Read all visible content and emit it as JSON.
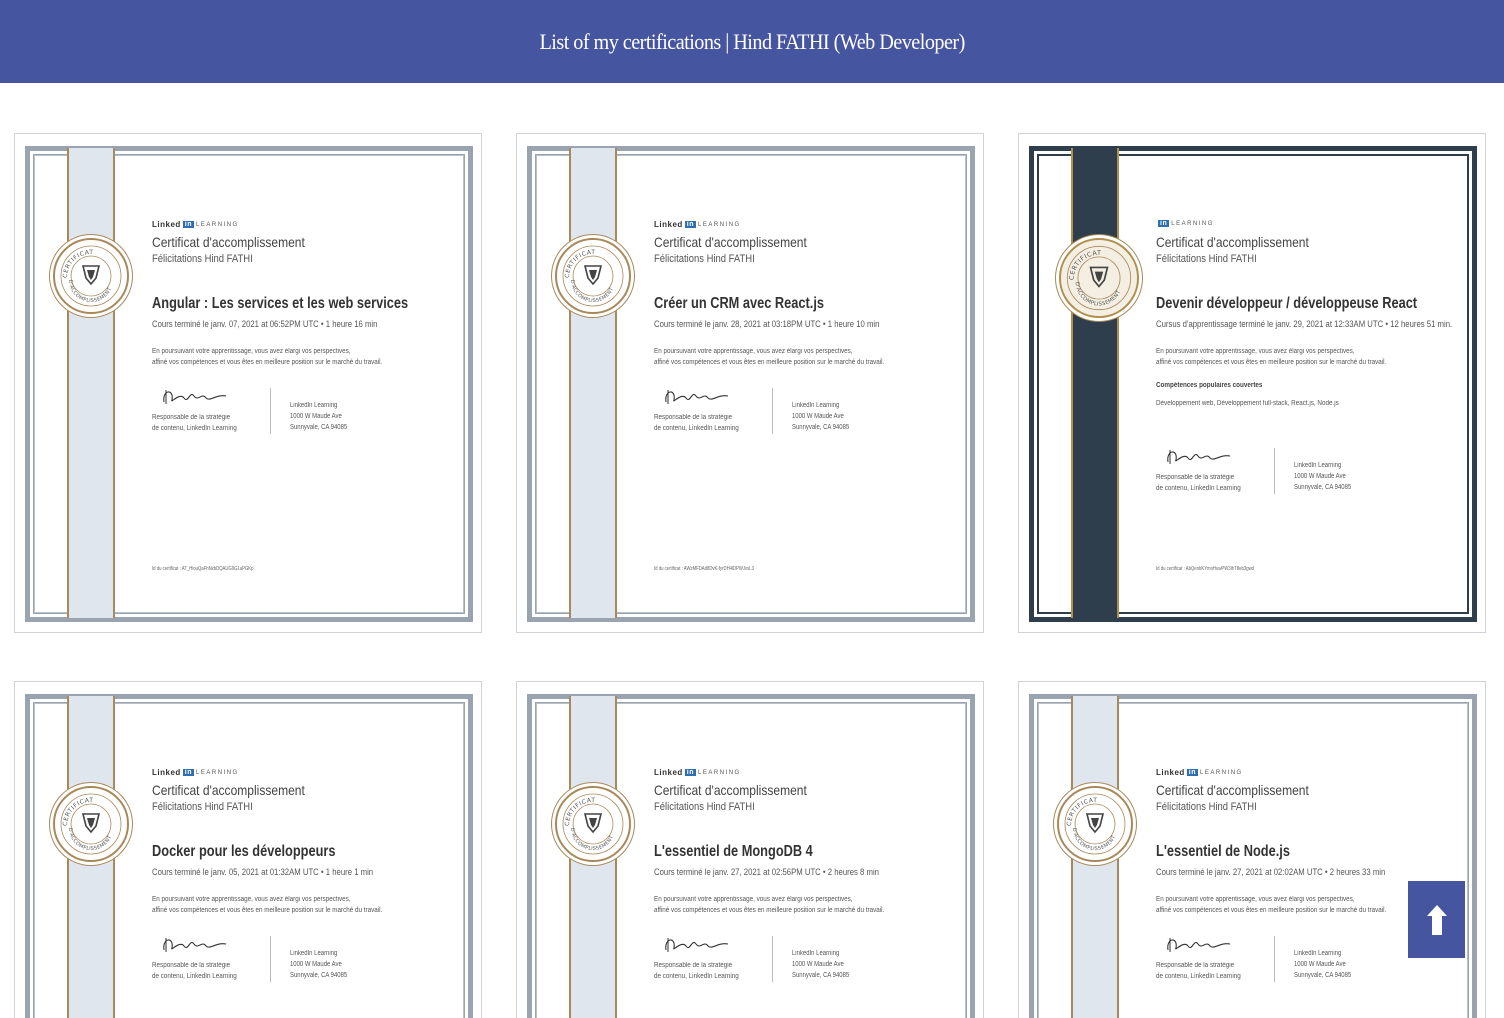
{
  "header": {
    "title": "List of my certifications | Hind FATHI (Web Developer)"
  },
  "colors": {
    "header_bg": "#46559f",
    "seal_gold": "#a8895b",
    "band_light": "#dfe6ee",
    "band_dark": "#2f3e4c"
  },
  "back_to_top": {
    "icon": "arrow-up-icon"
  },
  "certificates": [
    {
      "brand": "Linked",
      "brand_in": "in",
      "brand_suffix": "LEARNING",
      "label": "Certificat d'accomplissement",
      "congrats": "Félicitations Hind FATHI",
      "course": "Angular : Les services et les web services",
      "completion": "Cours terminé le janv. 07, 2021 at 06:52PM UTC • 1 heure 16 min",
      "desc1": "En poursuivant votre apprentissage, vous avez élargi vos perspectives,",
      "desc2": "affiné vos compétences et vous êtes en meilleure position sur le marché du travail.",
      "signer1": "Responsable de la stratégie",
      "signer2": "de contenu, LinkedIn Learning",
      "addr1": "LinkedIn Learning",
      "addr2": "1000 W Maude Ave",
      "addr3": "Sunnyvale, CA 94085",
      "cert_id": "Id du certificat : AT_HiouQaFhNxbDQAUG9G1aPGKp"
    },
    {
      "brand": "Linked",
      "brand_in": "in",
      "brand_suffix": "LEARNING",
      "label": "Certificat d'accomplissement",
      "congrats": "Félicitations Hind FATHI",
      "course": "Créer un CRM avec React.js",
      "completion": "Cours terminé le janv. 28, 2021 at 03:18PM UTC • 1 heure 10 min",
      "desc1": "En poursuivant votre apprentissage, vous avez élargi vos perspectives,",
      "desc2": "affiné vos compétences et vous êtes en meilleure position sur le marché du travail.",
      "signer1": "Responsable de la stratégie",
      "signer2": "de contenu, LinkedIn Learning",
      "addr1": "LinkedIn Learning",
      "addr2": "1000 W Maude Ave",
      "addr3": "Sunnyvale, CA 94085",
      "cert_id": "Id du certificat : AWzMFDAd8DvK-fyrDH4lDPWJvxL3"
    },
    {
      "brand": "",
      "brand_in": "in",
      "brand_suffix": "LEARNING",
      "label": "Certificat d'accomplissement",
      "congrats": "Félicitations Hind FATHI",
      "course": "Devenir développeur / développeuse React",
      "completion": "Cursus d'apprentissage terminé le janv. 29, 2021 at 12:33AM UTC • 12 heures 51 min.",
      "desc1": "En poursuivant votre apprentissage, vous avez élargi vos perspectives,",
      "desc2": "affiné vos compétences et vous êtes en meilleure position sur le marché du travail.",
      "skills_heading": "Compétences populaires couvertes",
      "skills": "Développement web, Développement full-stack, React.js, Node.js",
      "signer1": "Responsable de la stratégie",
      "signer2": "de contenu, LinkedIn Learning",
      "addr1": "LinkedIn Learning",
      "addr2": "1000 W Maude Ave",
      "addr3": "Sunnyvale, CA 94085",
      "cert_id": "Id du certificat : AbQenbKYmoHuwPW3IhT8eb3gwd"
    },
    {
      "brand": "Linked",
      "brand_in": "in",
      "brand_suffix": "LEARNING",
      "label": "Certificat d'accomplissement",
      "congrats": "Félicitations Hind FATHI",
      "course": "Docker pour les développeurs",
      "completion": "Cours terminé le janv. 05, 2021 at 01:32AM UTC • 1 heure 1 min",
      "desc1": "En poursuivant votre apprentissage, vous avez élargi vos perspectives,",
      "desc2": "affiné vos compétences et vous êtes en meilleure position sur le marché du travail.",
      "signer1": "Responsable de la stratégie",
      "signer2": "de contenu, LinkedIn Learning",
      "addr1": "LinkedIn Learning",
      "addr2": "1000 W Maude Ave",
      "addr3": "Sunnyvale, CA 94085"
    },
    {
      "brand": "Linked",
      "brand_in": "in",
      "brand_suffix": "LEARNING",
      "label": "Certificat d'accomplissement",
      "congrats": "Félicitations Hind FATHI",
      "course": "L'essentiel de MongoDB 4",
      "completion": "Cours terminé le janv. 27, 2021 at 02:56PM UTC • 2 heures 8 min",
      "desc1": "En poursuivant votre apprentissage, vous avez élargi vos perspectives,",
      "desc2": "affiné vos compétences et vous êtes en meilleure position sur le marché du travail.",
      "signer1": "Responsable de la stratégie",
      "signer2": "de contenu, LinkedIn Learning",
      "addr1": "LinkedIn Learning",
      "addr2": "1000 W Maude Ave",
      "addr3": "Sunnyvale, CA 94085"
    },
    {
      "brand": "Linked",
      "brand_in": "in",
      "brand_suffix": "LEARNING",
      "label": "Certificat d'accomplissement",
      "congrats": "Félicitations Hind FATHI",
      "course": "L'essentiel de Node.js",
      "completion": "Cours terminé le janv. 27, 2021 at 02:02AM UTC • 2 heures 33 min",
      "desc1": "En poursuivant votre apprentissage, vous avez élargi vos perspectives,",
      "desc2": "affiné vos compétences et vous êtes en meilleure position sur le marché du travail.",
      "signer1": "Responsable de la stratégie",
      "signer2": "de contenu, LinkedIn Learning",
      "addr1": "LinkedIn Learning",
      "addr2": "1000 W Maude Ave",
      "addr3": "Sunnyvale, CA 94085"
    }
  ]
}
